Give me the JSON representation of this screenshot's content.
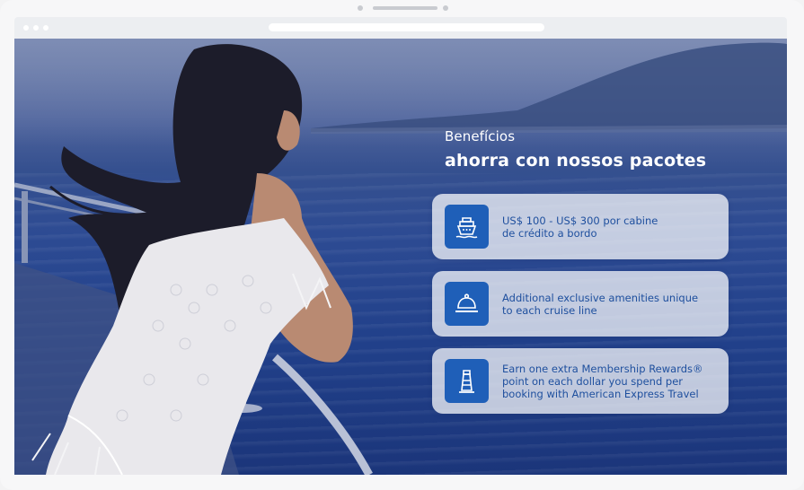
{
  "hero": {
    "eyebrow": "Benefícios",
    "headline": "ahorra con nossos pacotes"
  },
  "benefits": [
    {
      "icon": "cruise-ship-icon",
      "text": "US$ 100 - US$ 300 por cabine\nde crédito a bordo"
    },
    {
      "icon": "room-service-bell-icon",
      "text": "Additional exclusive amenities unique\nto each cruise line"
    },
    {
      "icon": "lighthouse-icon",
      "text": "Earn one extra Membership Rewards®\npoint on each dollar you spend per\nbooking with American Express Travel"
    }
  ],
  "colors": {
    "accent": "#1f5fb8",
    "card_text": "#1e4f9e",
    "overlay": "#2d4b93"
  }
}
